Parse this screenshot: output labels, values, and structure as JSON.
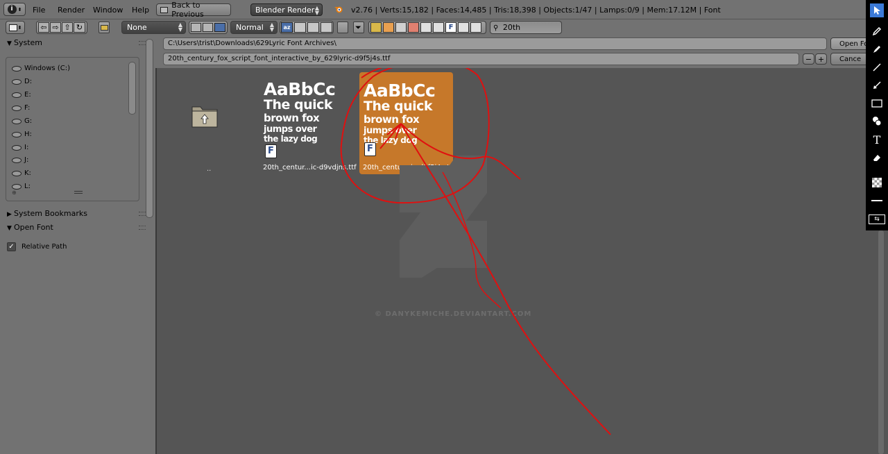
{
  "header": {
    "menus": [
      "File",
      "Render",
      "Window",
      "Help"
    ],
    "back_button": "Back to Previous",
    "render_engine": "Blender Render",
    "stats": "v2.76 | Verts:15,182 | Faces:14,485 | Tris:18,398 | Objects:1/47 | Lamps:0/9 | Mem:17.12M | Font"
  },
  "toolbar": {
    "display_mode": "None",
    "sort_mode": "Normal",
    "filter_text": "20th"
  },
  "sidebar": {
    "system_title": "System",
    "drives": [
      "Windows (C:)",
      "D:",
      "E:",
      "F:",
      "G:",
      "H:",
      "I:",
      "J:",
      "K:",
      "L:"
    ],
    "bookmarks_title": "System Bookmarks",
    "open_font_title": "Open Font",
    "relative_path_label": "Relative Path",
    "relative_path_checked": true
  },
  "pathbar": {
    "directory": "C:\\Users\\trist\\Downloads\\629Lyric Font Archives\\",
    "filename": "20th_century_fox_script_font_interactive_by_629lyric-d9f5j4s.ttf",
    "open_button": "Open Fo",
    "cancel_button": "Cance",
    "decrement": "−",
    "increment": "+"
  },
  "files": {
    "parent_label": "..",
    "items": [
      {
        "label": "20th_centur...ic-d9vdjns.ttf",
        "preview": [
          "AaBbCc",
          "The quick",
          "brown fox",
          "jumps over",
          "the lazy dog"
        ],
        "selected": false
      },
      {
        "label": "20th_centur...ic-d9f5j4s.ttf",
        "preview": [
          "AaBbCc",
          "The quick",
          "brown fox",
          "jumps over",
          "the lazy dog"
        ],
        "selected": true
      }
    ]
  },
  "watermark": "© DANYKEMICHE.DEVIANTART.COM",
  "colors": {
    "selection": "#c6782a",
    "annotation": "#e01010",
    "tool_active": "#3b7ad8"
  },
  "tools": [
    "pointer-icon",
    "pencil-icon",
    "marker-icon",
    "line-icon",
    "arrow-icon",
    "rectangle-icon",
    "counter-icon",
    "text-icon",
    "eraser-icon",
    "checker-icon",
    "stroke-icon",
    "swap-icon"
  ]
}
